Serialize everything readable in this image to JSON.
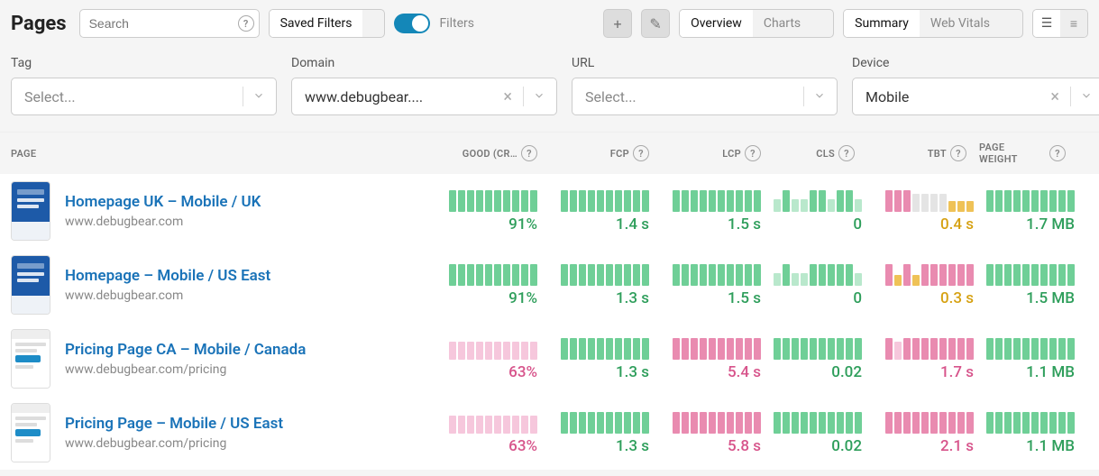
{
  "header": {
    "title": "Pages",
    "search_placeholder": "Search",
    "saved_filters_label": "Saved Filters",
    "filters_label": "Filters",
    "filters_on": true,
    "overview_label": "Overview",
    "charts_label": "Charts",
    "summary_label": "Summary",
    "web_vitals_label": "Web Vitals"
  },
  "filters": {
    "tag": {
      "label": "Tag",
      "value": "",
      "placeholder": "Select..."
    },
    "domain": {
      "label": "Domain",
      "value": "www.debugbear...."
    },
    "url": {
      "label": "URL",
      "value": "",
      "placeholder": "Select..."
    },
    "device": {
      "label": "Device",
      "value": "Mobile"
    }
  },
  "columns": {
    "page": "PAGE",
    "good": "GOOD (CR…",
    "fcp": "FCP",
    "lcp": "LCP",
    "cls": "CLS",
    "tbt": "TBT",
    "weight": "PAGE WEIGHT"
  },
  "rows": [
    {
      "thumb": "blue",
      "name": "Homepage UK – Mobile / UK",
      "url": "www.debugbear.com",
      "metrics": {
        "good": {
          "value": "91%",
          "status": "green",
          "bars": [
            "g",
            "g",
            "g",
            "g",
            "g",
            "g",
            "g",
            "g",
            "g",
            "g"
          ]
        },
        "fcp": {
          "value": "1.4 s",
          "status": "green",
          "bars": [
            "g",
            "g",
            "g",
            "g",
            "g",
            "g",
            "g",
            "g",
            "g",
            "g"
          ]
        },
        "lcp": {
          "value": "1.5 s",
          "status": "green",
          "bars": [
            "g",
            "g",
            "g",
            "g",
            "g",
            "g",
            "g",
            "g",
            "g",
            "g"
          ]
        },
        "cls": {
          "value": "0",
          "status": "green",
          "bars": [
            "gl",
            "g",
            "gl",
            "gl",
            "g",
            "g",
            "gl",
            "g",
            "g",
            "gl"
          ]
        },
        "tbt": {
          "value": "0.4 s",
          "status": "amber",
          "bars": [
            "p",
            "p",
            "p",
            "x",
            "x",
            "x",
            "x",
            "a",
            "a",
            "a"
          ]
        },
        "weight": {
          "value": "1.7 MB",
          "status": "green",
          "bars": [
            "g",
            "g",
            "g",
            "g",
            "g",
            "g",
            "g",
            "g",
            "g",
            "g"
          ]
        }
      }
    },
    {
      "thumb": "blue",
      "name": "Homepage – Mobile / US East",
      "url": "www.debugbear.com",
      "metrics": {
        "good": {
          "value": "91%",
          "status": "green",
          "bars": [
            "g",
            "g",
            "g",
            "g",
            "g",
            "g",
            "g",
            "g",
            "g",
            "g"
          ]
        },
        "fcp": {
          "value": "1.3 s",
          "status": "green",
          "bars": [
            "g",
            "g",
            "g",
            "g",
            "g",
            "g",
            "g",
            "g",
            "g",
            "g"
          ]
        },
        "lcp": {
          "value": "1.5 s",
          "status": "green",
          "bars": [
            "g",
            "g",
            "g",
            "g",
            "g",
            "g",
            "g",
            "g",
            "g",
            "g"
          ]
        },
        "cls": {
          "value": "0",
          "status": "green",
          "bars": [
            "gl",
            "g",
            "gl",
            "gl",
            "g",
            "g",
            "g",
            "g",
            "g",
            "gl"
          ]
        },
        "tbt": {
          "value": "0.3 s",
          "status": "amber",
          "bars": [
            "p",
            "a",
            "p",
            "a",
            "p",
            "p",
            "p",
            "p",
            "p",
            "p"
          ]
        },
        "weight": {
          "value": "1.5 MB",
          "status": "green",
          "bars": [
            "g",
            "g",
            "g",
            "g",
            "g",
            "g",
            "g",
            "g",
            "g",
            "g"
          ]
        }
      }
    },
    {
      "thumb": "light",
      "name": "Pricing Page CA – Mobile / Canada",
      "url": "www.debugbear.com/pricing",
      "metrics": {
        "good": {
          "value": "63%",
          "status": "pink",
          "bars": [
            "pl",
            "pl",
            "pl",
            "pl",
            "pl",
            "pl",
            "pl",
            "pl",
            "pl",
            "pl"
          ]
        },
        "fcp": {
          "value": "1.3 s",
          "status": "green",
          "bars": [
            "g",
            "g",
            "g",
            "g",
            "g",
            "g",
            "g",
            "g",
            "g",
            "g"
          ]
        },
        "lcp": {
          "value": "5.4 s",
          "status": "pink",
          "bars": [
            "p",
            "p",
            "p",
            "p",
            "p",
            "p",
            "p",
            "p",
            "p",
            "p"
          ]
        },
        "cls": {
          "value": "0.02",
          "status": "green",
          "bars": [
            "g",
            "g",
            "g",
            "g",
            "g",
            "g",
            "g",
            "g",
            "g",
            "g"
          ]
        },
        "tbt": {
          "value": "1.7 s",
          "status": "pink",
          "bars": [
            "p",
            "pl",
            "p",
            "p",
            "p",
            "p",
            "p",
            "p",
            "p",
            "p"
          ]
        },
        "weight": {
          "value": "1.1 MB",
          "status": "green",
          "bars": [
            "g",
            "g",
            "g",
            "g",
            "g",
            "g",
            "g",
            "g",
            "g",
            "g"
          ]
        }
      }
    },
    {
      "thumb": "light",
      "name": "Pricing Page – Mobile / US East",
      "url": "www.debugbear.com/pricing",
      "metrics": {
        "good": {
          "value": "63%",
          "status": "pink",
          "bars": [
            "pl",
            "pl",
            "pl",
            "pl",
            "pl",
            "pl",
            "pl",
            "pl",
            "pl",
            "pl"
          ]
        },
        "fcp": {
          "value": "1.3 s",
          "status": "green",
          "bars": [
            "g",
            "g",
            "g",
            "g",
            "g",
            "g",
            "g",
            "g",
            "g",
            "g"
          ]
        },
        "lcp": {
          "value": "5.8 s",
          "status": "pink",
          "bars": [
            "p",
            "p",
            "p",
            "p",
            "p",
            "p",
            "p",
            "p",
            "p",
            "p"
          ]
        },
        "cls": {
          "value": "0.02",
          "status": "green",
          "bars": [
            "g",
            "g",
            "g",
            "g",
            "g",
            "g",
            "g",
            "g",
            "g",
            "g"
          ]
        },
        "tbt": {
          "value": "2.1 s",
          "status": "pink",
          "bars": [
            "p",
            "p",
            "p",
            "p",
            "p",
            "p",
            "p",
            "p",
            "p",
            "p"
          ]
        },
        "weight": {
          "value": "1.1 MB",
          "status": "green",
          "bars": [
            "g",
            "g",
            "g",
            "g",
            "g",
            "g",
            "g",
            "g",
            "g",
            "g"
          ]
        }
      }
    }
  ]
}
